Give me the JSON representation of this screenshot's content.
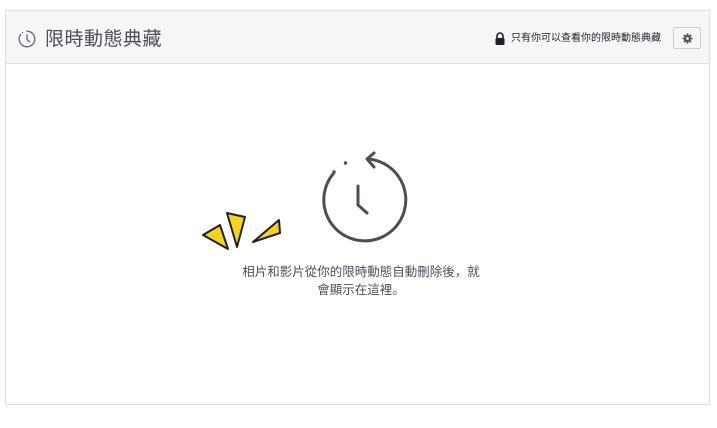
{
  "header": {
    "title": "限時動態典藏",
    "title_icon": "clock-icon",
    "privacy_icon": "lock-icon",
    "privacy_text": "只有你可以查看你的限時動態典藏",
    "settings_icon": "gear-icon"
  },
  "empty_state": {
    "illustration_icon": "clock-rewind-icon",
    "sparkle_icon": "yellow-sparkles-icon",
    "message_line1": "相片和影片從你的限時動態自動刪除後，就",
    "message_line2": "會顯示在這裡。"
  },
  "colors": {
    "header_bg": "#f5f6f7",
    "border": "#dddfe2",
    "text": "#4b4f56",
    "sparkle_yellow": "#f7d417"
  }
}
